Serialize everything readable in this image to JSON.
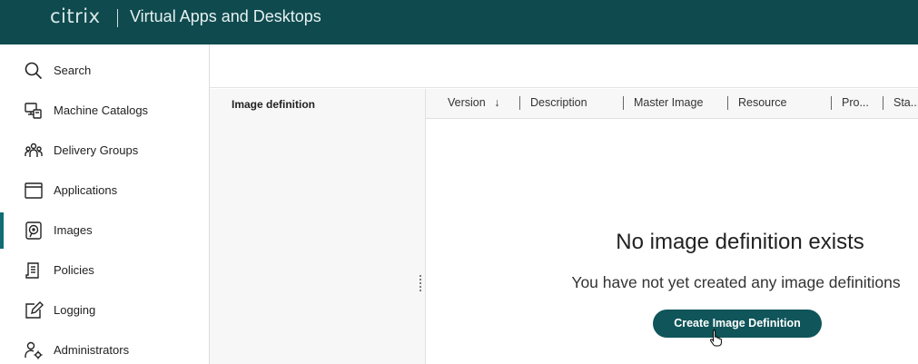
{
  "header": {
    "brand": "citrix",
    "app_title": "Virtual Apps and Desktops",
    "background": "#0f4a4e"
  },
  "sidebar": {
    "active_color": "#0f6d73",
    "items": [
      {
        "label": "Search",
        "icon": "search-icon"
      },
      {
        "label": "Machine Catalogs",
        "icon": "machine-catalogs-icon"
      },
      {
        "label": "Delivery Groups",
        "icon": "delivery-groups-icon"
      },
      {
        "label": "Applications",
        "icon": "applications-icon"
      },
      {
        "label": "Images",
        "icon": "images-icon",
        "active": true
      },
      {
        "label": "Policies",
        "icon": "policies-icon"
      },
      {
        "label": "Logging",
        "icon": "logging-icon"
      },
      {
        "label": "Administrators",
        "icon": "administrators-icon"
      }
    ]
  },
  "definition_panel": {
    "heading": "Image definition"
  },
  "table": {
    "columns": [
      {
        "label": "Version",
        "sort": "descending"
      },
      {
        "label": "Description"
      },
      {
        "label": "Master Image"
      },
      {
        "label": "Resource"
      },
      {
        "label": "Pro..."
      },
      {
        "label": "Sta..."
      }
    ]
  },
  "empty_state": {
    "title": "No image definition exists",
    "subtitle": "You have not yet created any image definitions",
    "button_label": "Create Image Definition"
  }
}
